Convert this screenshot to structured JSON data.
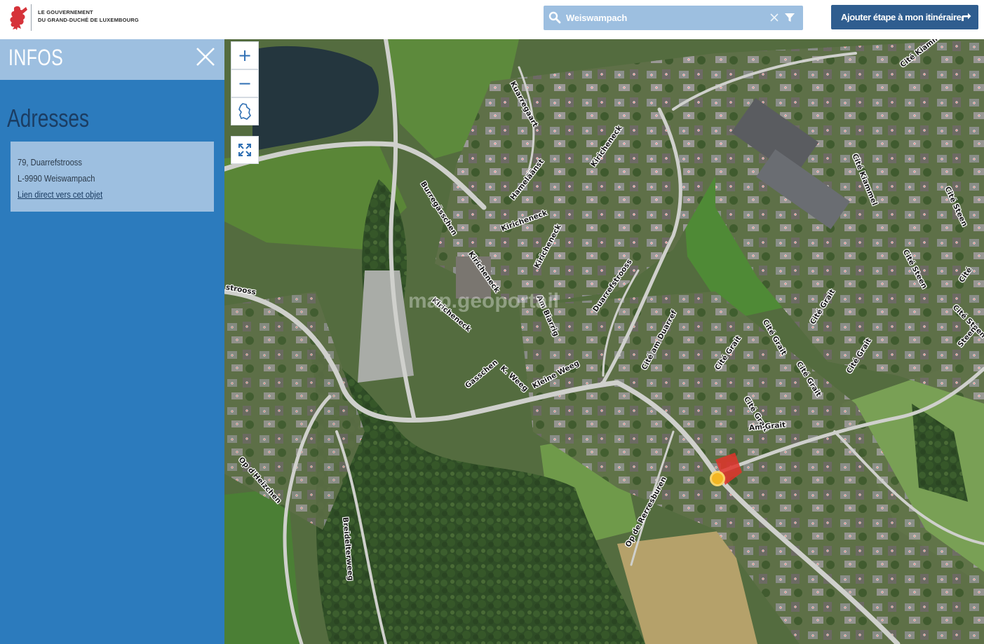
{
  "header": {
    "gov_line1": "LE GOUVERNEMENT",
    "gov_line2": "DU GRAND-DUCHÉ DE LUXEMBOURG",
    "search_value": "Weiswampach",
    "itinerary_label": "Ajouter étape à mon itinéraire"
  },
  "sidebar": {
    "title": "INFOS",
    "section_title": "Adresses",
    "address": {
      "street": "79, Duarrefstrooss",
      "city": "L-9990 Weiswampach",
      "link": "Lien direct vers cet objet"
    }
  },
  "map": {
    "controls": {
      "zoom_in": "+",
      "zoom_out": "−"
    },
    "watermark": "map.geoportail",
    "streets": [
      "Kuarregaart",
      "Cité Kiammel",
      "Burregässchen",
      "Hameläänst",
      "Kiricheneck",
      "Kiricheneck",
      "Kiricheneck",
      "Kiricheneck",
      "Kiricheneck",
      "Am Biarrig",
      "Duarrefstrooss",
      "Cité am Duarref",
      "Cité Grait",
      "Cité Grait",
      "Cité Grait",
      "Cité Grait",
      "Cité Grait",
      "Cité Grait",
      "Am Grait",
      "Cité Kiammel",
      "Cité Steen",
      "Cité Steen",
      "Cité Steen",
      "Cité",
      "Steen",
      "Gasschen",
      "K. Weeg",
      "Kleine Weeg",
      "strooss",
      "Op d'Heizchen",
      "Breidelterweeg",
      "Op de Rerresburen"
    ]
  },
  "colors": {
    "accent_blue": "#2c7bbd",
    "light_blue": "#9dbfe0",
    "button_blue": "#2f5d8f",
    "title_dark": "#1b3d63",
    "marker": "#f4b623",
    "selection": "#e0332a"
  }
}
